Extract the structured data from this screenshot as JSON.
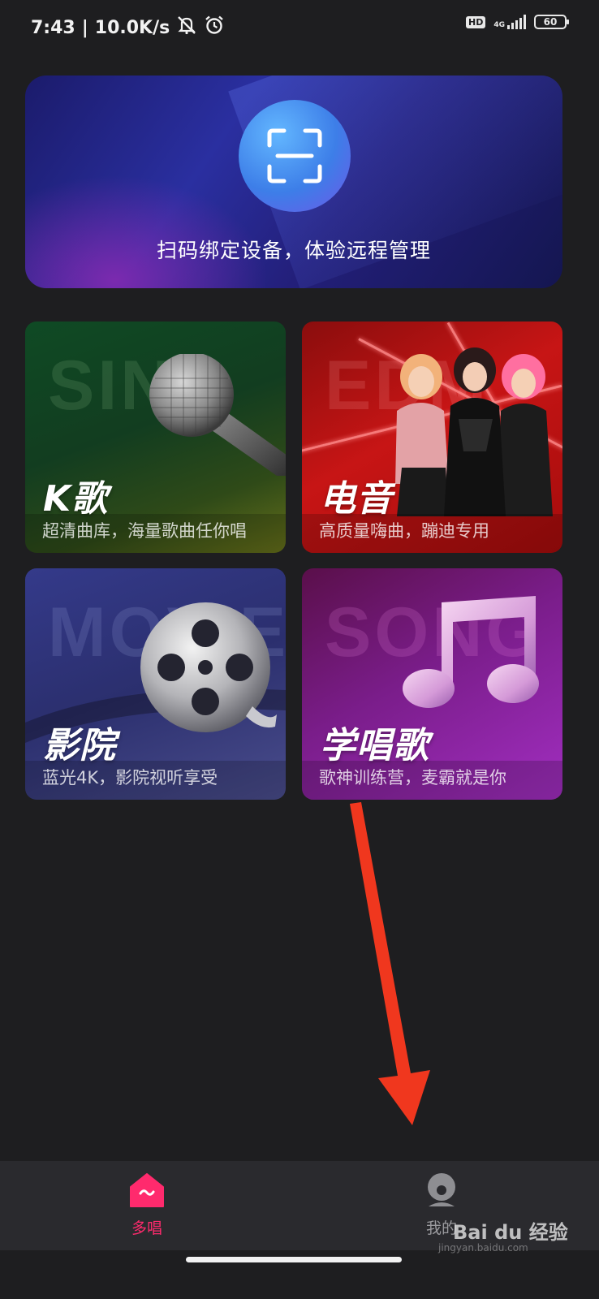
{
  "status_bar": {
    "time": "7:43",
    "separator": "|",
    "speed": "10.0K/s",
    "hd": "HD",
    "network": "4G",
    "battery": "60",
    "icons": [
      "mute-bell-icon",
      "alarm-icon",
      "signal-icon",
      "battery-icon"
    ]
  },
  "scan": {
    "icon": "scan-qr-icon",
    "text": "扫码绑定设备，体验远程管理"
  },
  "tiles": [
    {
      "bg_word": "SING",
      "title": "K歌",
      "subtitle": "超清曲库，海量歌曲任你唱",
      "icon": "microphone-icon"
    },
    {
      "bg_word": "EDM",
      "title": "电音",
      "subtitle": "高质量嗨曲，蹦迪专用",
      "icon": "performers-image"
    },
    {
      "bg_word": "MOVIE",
      "title": "影院",
      "subtitle": "蓝光4K，影院视听享受",
      "icon": "film-reel-icon"
    },
    {
      "bg_word": "SONG",
      "title": "学唱歌",
      "subtitle": "歌神训练营，麦霸就是你",
      "icon": "music-note-icon"
    }
  ],
  "bottom_nav": [
    {
      "label": "多唱",
      "icon": "home-icon",
      "active": true,
      "color": "#ff2a6d"
    },
    {
      "label": "我的",
      "icon": "profile-icon",
      "active": false
    }
  ],
  "watermark": {
    "text": "Bai du 经验",
    "sub": "jingyan.baidu.com"
  },
  "annotation": {
    "icon": "red-arrow-annotation",
    "color": "#f0371e"
  }
}
